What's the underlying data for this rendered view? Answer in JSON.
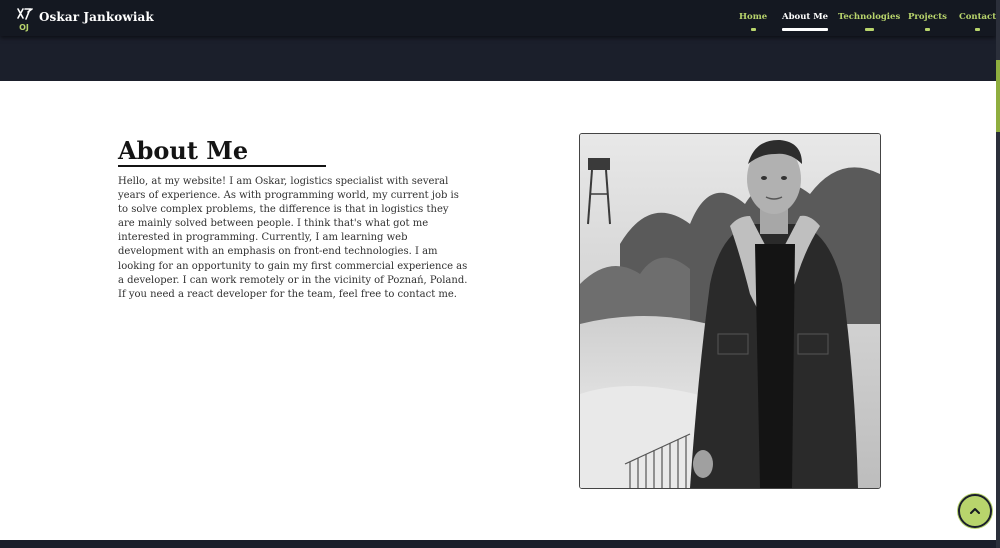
{
  "header": {
    "brand": "Oskar Jankowiak",
    "logo_initials": "OJ",
    "nav": [
      {
        "label": "Home",
        "active": false
      },
      {
        "label": "About Me",
        "active": true
      },
      {
        "label": "Technologies",
        "active": false
      },
      {
        "label": "Projects",
        "active": false
      },
      {
        "label": "Contact",
        "active": false
      }
    ]
  },
  "about": {
    "title": "About Me",
    "text": "Hello, at my website! I am Oskar, logistics specialist with several years of experience. As with programming world, my current job is to solve complex problems, the difference is that in logistics they are mainly solved between people. I think that's what got me interested in programming. Currently, I am learning web development with an emphasis on front-end technologies. I am looking for an opportunity to gain my first commercial experience as a developer. I can work remotely or in the vicinity of Poznań, Poland. If you need a react developer for the team, feel free to contact me."
  },
  "icons": {
    "scroll_top": "chevron-up-icon",
    "logo": "oj-monogram-icon"
  },
  "colors": {
    "accent": "#b8d46c",
    "navbar": "#141821",
    "hero": "#1b1f2b",
    "content_bg": "#ffffff",
    "text": "#303030"
  }
}
